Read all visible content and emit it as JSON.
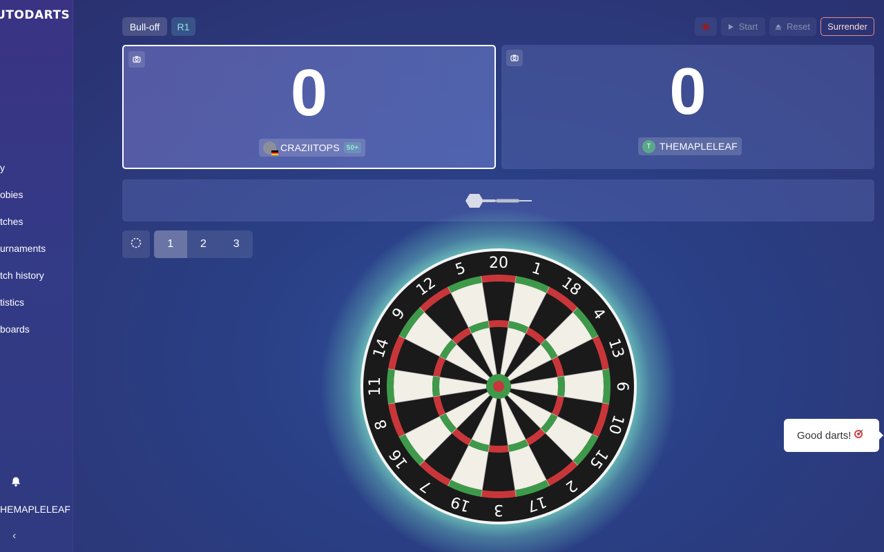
{
  "app": {
    "logo_text": "UTODARTS"
  },
  "sidebar": {
    "items": [
      {
        "label": "y"
      },
      {
        "label": "obies"
      },
      {
        "label": "tches"
      },
      {
        "label": "urnaments"
      },
      {
        "label": "tch history"
      },
      {
        "label": "tistics"
      },
      {
        "label": " boards"
      }
    ],
    "user": "HEMAPLELEAF",
    "collapse_glyph": "‹",
    "bell_icon": "bell-icon"
  },
  "topbar": {
    "mode_label": "Bull-off",
    "round_label": "R1",
    "start_label": "Start",
    "reset_label": "Reset",
    "surrender_label": "Surrender",
    "record_color": "#8a2230"
  },
  "players": [
    {
      "score": "0",
      "name": "CRAZIITOPS",
      "badge": "50+",
      "active": true,
      "flag": "germany"
    },
    {
      "score": "0",
      "name": "THEMAPLELEAF",
      "initial": "T",
      "active": false
    }
  ],
  "throws": {
    "buttons": [
      "1",
      "2",
      "3"
    ],
    "active_index": 0
  },
  "toast": {
    "text": "Good darts!"
  },
  "dartboard": {
    "numbers": [
      "20",
      "1",
      "18",
      "4",
      "13",
      "6",
      "10",
      "15",
      "2",
      "17",
      "3",
      "19",
      "7",
      "16",
      "8",
      "11",
      "14",
      "9",
      "12",
      "5"
    ],
    "colors": {
      "red": "#c8363a",
      "green": "#3e9a4a",
      "black": "#1a1a1a",
      "cream": "#f2efe6",
      "glow": "#7ee6c8"
    }
  }
}
